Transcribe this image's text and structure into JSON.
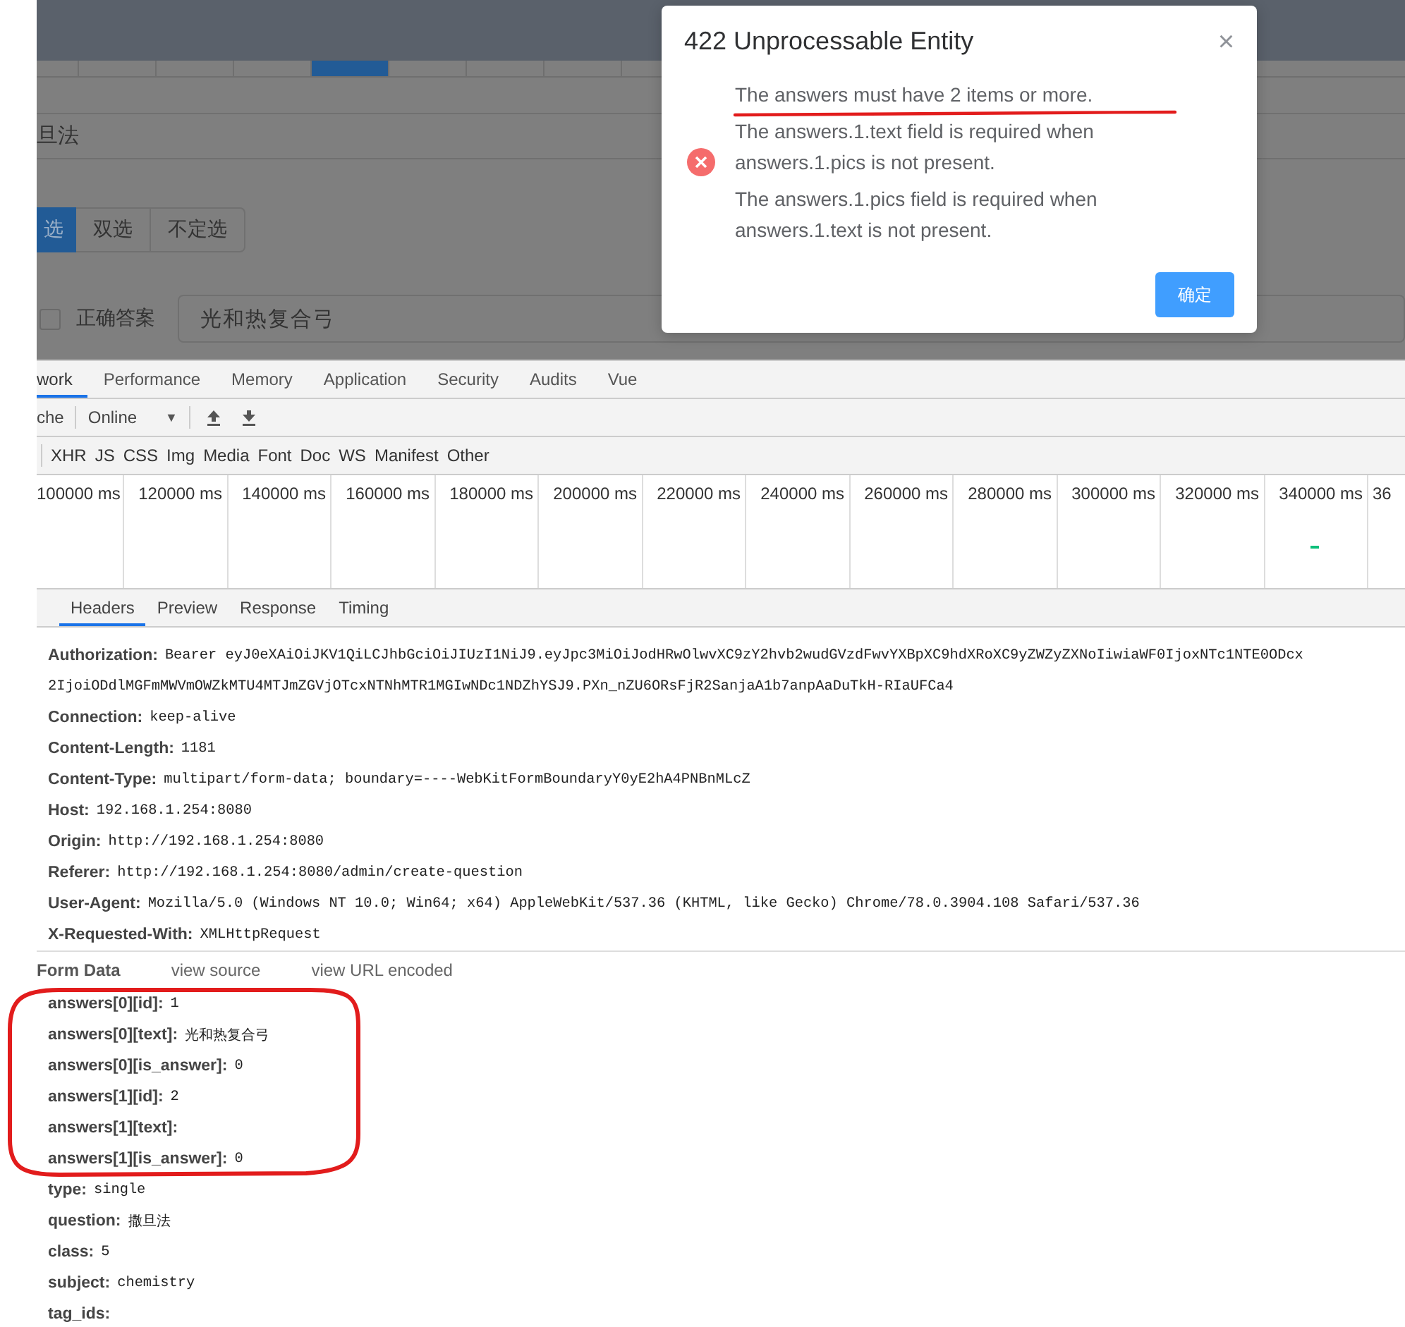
{
  "page": {
    "tabs": [
      {
        "selected": false
      },
      {
        "selected": false
      },
      {
        "selected": false
      },
      {
        "selected": false
      },
      {
        "selected": true
      },
      {
        "selected": false
      },
      {
        "selected": false
      },
      {
        "selected": false
      }
    ],
    "question": "旦法",
    "type_options": [
      {
        "label": "选",
        "selected": true
      },
      {
        "label": "双选",
        "selected": false
      },
      {
        "label": "不定选",
        "selected": false
      }
    ],
    "answer": {
      "checked": false,
      "label": "正确答案",
      "value": "光和热复合弓"
    }
  },
  "dialog": {
    "title": "422 Unprocessable Entity",
    "close": "×",
    "messages": [
      "The answers must have 2 items or more.",
      "The answers.1.text field is required when answers.1.pics is not present.",
      "The answers.1.pics field is required when answers.1.text is not present."
    ],
    "ok": "确定"
  },
  "devtools": {
    "tabs": [
      {
        "label": "work",
        "selected": true
      },
      {
        "label": "Performance",
        "selected": false
      },
      {
        "label": "Memory",
        "selected": false
      },
      {
        "label": "Application",
        "selected": false
      },
      {
        "label": "Security",
        "selected": false
      },
      {
        "label": "Audits",
        "selected": false
      },
      {
        "label": "Vue",
        "selected": false
      }
    ],
    "toolbar": {
      "cache": "che",
      "throttle": "Online",
      "caret": "▼"
    },
    "filters": [
      "XHR",
      "JS",
      "CSS",
      "Img",
      "Media",
      "Font",
      "Doc",
      "WS",
      "Manifest",
      "Other"
    ],
    "timeline": [
      "100000 ms",
      "120000 ms",
      "140000 ms",
      "160000 ms",
      "180000 ms",
      "200000 ms",
      "220000 ms",
      "240000 ms",
      "260000 ms",
      "280000 ms",
      "300000 ms",
      "320000 ms",
      "340000 ms",
      "36"
    ],
    "detail_tabs": [
      {
        "label": "Headers",
        "selected": true
      },
      {
        "label": "Preview",
        "selected": false
      },
      {
        "label": "Response",
        "selected": false
      },
      {
        "label": "Timing",
        "selected": false
      }
    ],
    "headers": [
      {
        "name": "Authorization:",
        "value": "Bearer eyJ0eXAiOiJKV1QiLCJhbGciOiJIUzI1NiJ9.eyJpc3MiOiJodHRwOlwvXC9zY2hvb2wudGVzdFwvYXBpXC9hdXRoXC9yZWZyZXNoIiwiaWF0IjoxNTc1NTE0ODcx",
        "continuation": "2IjoiODdlMGFmMWVmOWZkMTU4MTJmZGVjOTcxNTNhMTR1MGIwNDc1NDZhYSJ9.PXn_nZU6ORsFjR2SanjaA1b7anpAaDuTkH-RIaUFCa4"
      },
      {
        "name": "Connection:",
        "value": "keep-alive"
      },
      {
        "name": "Content-Length:",
        "value": "1181"
      },
      {
        "name": "Content-Type:",
        "value": "multipart/form-data; boundary=----WebKitFormBoundaryY0yE2hA4PNBnMLcZ"
      },
      {
        "name": "Host:",
        "value": "192.168.1.254:8080"
      },
      {
        "name": "Origin:",
        "value": "http://192.168.1.254:8080"
      },
      {
        "name": "Referer:",
        "value": "http://192.168.1.254:8080/admin/create-question"
      },
      {
        "name": "User-Agent:",
        "value": "Mozilla/5.0 (Windows NT 10.0; Win64; x64) AppleWebKit/537.36 (KHTML, like Gecko) Chrome/78.0.3904.108 Safari/537.36"
      },
      {
        "name": "X-Requested-With:",
        "value": "XMLHttpRequest"
      }
    ],
    "form_data": {
      "title": "Form Data",
      "links": [
        "view source",
        "view URL encoded"
      ],
      "rows": [
        {
          "name": "answers[0][id]:",
          "value": "1"
        },
        {
          "name": "answers[0][text]:",
          "value": "光和热复合弓"
        },
        {
          "name": "answers[0][is_answer]:",
          "value": "0"
        },
        {
          "name": "answers[1][id]:",
          "value": "2"
        },
        {
          "name": "answers[1][text]:"
        },
        {
          "name": "answers[1][is_answer]:",
          "value": "0"
        },
        {
          "name": "type:",
          "value": "single"
        },
        {
          "name": "question:",
          "value": "撒旦法"
        },
        {
          "name": "class:",
          "value": "5"
        },
        {
          "name": "subject:",
          "value": "chemistry"
        },
        {
          "name": "tag_ids:"
        }
      ]
    }
  }
}
